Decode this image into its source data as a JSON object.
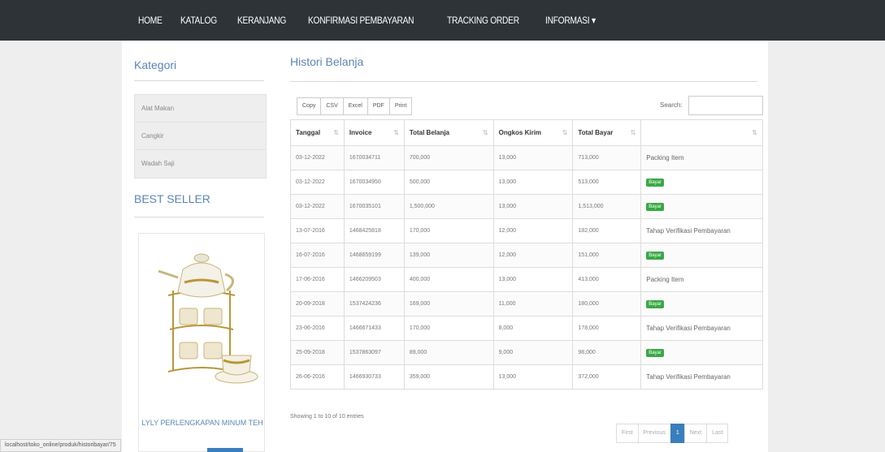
{
  "nav": {
    "items": [
      "HOME",
      "KATALOG",
      "KERANJANG",
      "KONFIRMASI PEMBAYARAN",
      "TRACKING ORDER",
      "INFORMASI ▾"
    ]
  },
  "sidebar": {
    "category_title": "Kategori",
    "categories": [
      "Alat Makan",
      "Cangkir",
      "Wadah Saji"
    ],
    "bestseller_title": "BEST SELLER",
    "product_name": "LYLY PERLENGKAPAN MINUM TEH"
  },
  "main": {
    "title": "Histori Belanja",
    "buttons": [
      "Copy",
      "CSV",
      "Excel",
      "PDF",
      "Print"
    ],
    "search_label": "Search:",
    "columns": [
      "Tanggal",
      "Invoice",
      "Total Belanja",
      "Ongkos Kirim",
      "Total Bayar",
      ""
    ],
    "rows": [
      {
        "tanggal": "03-12-2022",
        "invoice": "1670034711",
        "total_belanja": "700,000",
        "ongkir": "13,000",
        "total_bayar": "713,000",
        "status": "Packing Item",
        "badge": false
      },
      {
        "tanggal": "03-12-2022",
        "invoice": "1670034950",
        "total_belanja": "500,000",
        "ongkir": "13,000",
        "total_bayar": "513,000",
        "status": "Bayar",
        "badge": true
      },
      {
        "tanggal": "03-12-2022",
        "invoice": "1670035101",
        "total_belanja": "1,500,000",
        "ongkir": "13,000",
        "total_bayar": "1,513,000",
        "status": "Bayar",
        "badge": true
      },
      {
        "tanggal": "13-07-2016",
        "invoice": "1468425818",
        "total_belanja": "170,000",
        "ongkir": "12,000",
        "total_bayar": "182,000",
        "status": "Tahap Verifikasi Pembayaran",
        "badge": false
      },
      {
        "tanggal": "16-07-2016",
        "invoice": "1468659199",
        "total_belanja": "139,000",
        "ongkir": "12,000",
        "total_bayar": "151,000",
        "status": "Bayar",
        "badge": true
      },
      {
        "tanggal": "17-06-2016",
        "invoice": "1466209503",
        "total_belanja": "400,000",
        "ongkir": "13,000",
        "total_bayar": "413,000",
        "status": "Packing Item",
        "badge": false
      },
      {
        "tanggal": "20-09-2018",
        "invoice": "1537424236",
        "total_belanja": "169,000",
        "ongkir": "11,000",
        "total_bayar": "180,000",
        "status": "Bayar",
        "badge": true
      },
      {
        "tanggal": "23-06-2016",
        "invoice": "1466671433",
        "total_belanja": "170,000",
        "ongkir": "8,000",
        "total_bayar": "178,000",
        "status": "Tahap Verifikasi Pembayaran",
        "badge": false
      },
      {
        "tanggal": "25-09-2018",
        "invoice": "1537863097",
        "total_belanja": "89,000",
        "ongkir": "9,000",
        "total_bayar": "98,000",
        "status": "Bayar",
        "badge": true
      },
      {
        "tanggal": "26-06-2016",
        "invoice": "1466930733",
        "total_belanja": "359,000",
        "ongkir": "13,000",
        "total_bayar": "372,000",
        "status": "Tahap Verifikasi Pembayaran",
        "badge": false
      }
    ],
    "info": "Showing 1 to 10 of 10 entries",
    "pager": [
      "First",
      "Previous",
      "1",
      "Next",
      "Last"
    ],
    "active_page": "1"
  },
  "statusbar": {
    "url": "localhost/toko_online/produk/historibayar/75"
  },
  "colors": {
    "topbar": "#2e3338",
    "accent": "#5a86b5",
    "badge": "#39a845",
    "pager_active": "#3a7ebd"
  }
}
